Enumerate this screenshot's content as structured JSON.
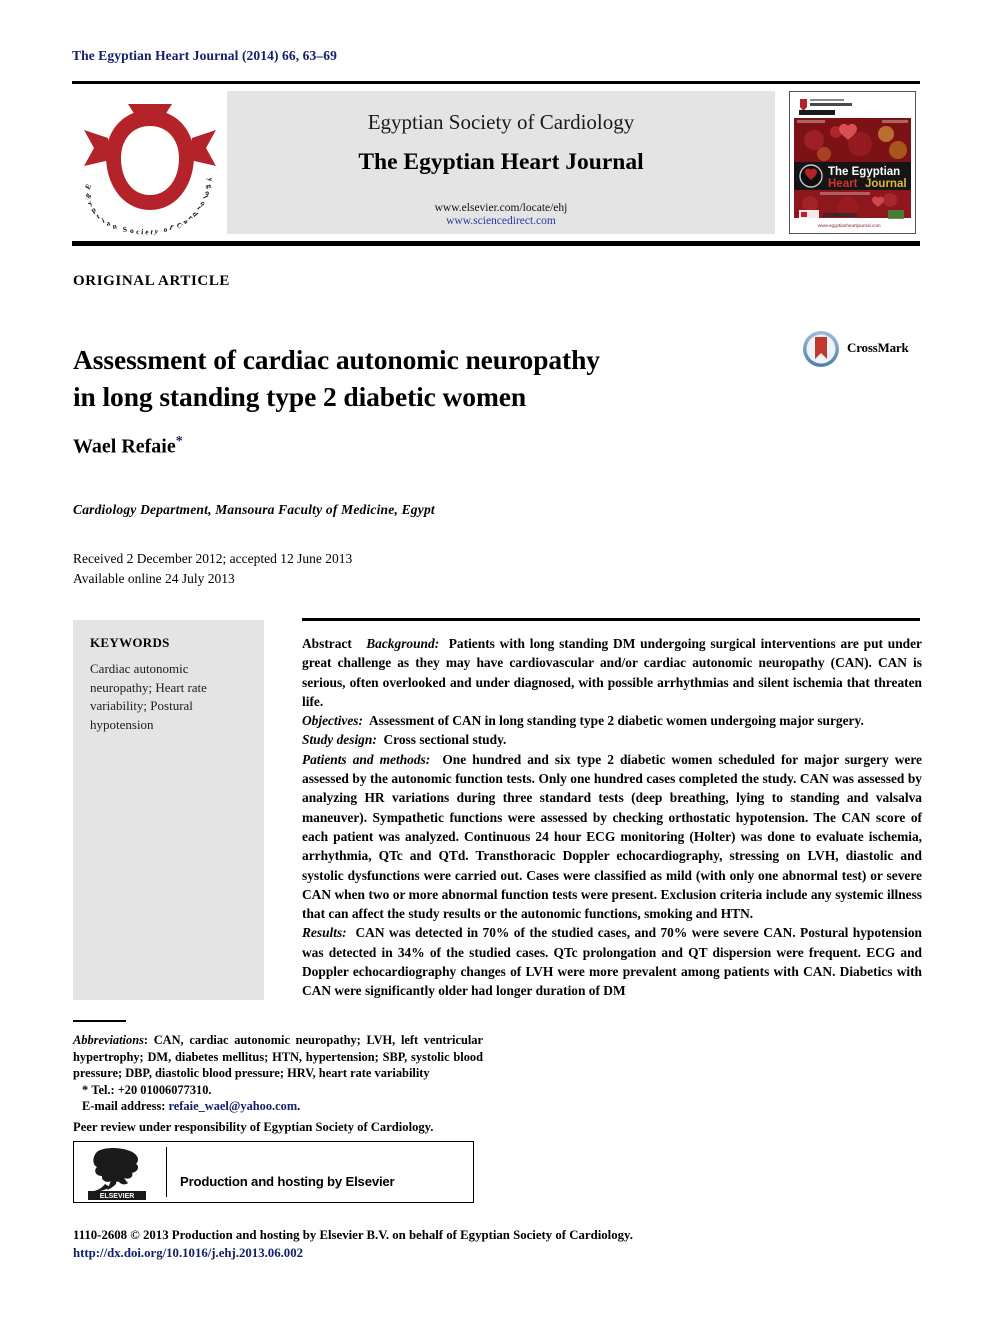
{
  "running_head": "The Egyptian Heart Journal (2014) 66, 63–69",
  "masthead": {
    "society": "Egyptian Society of Cardiology",
    "journal": "The Egyptian Heart Journal",
    "url_elsevier": "www.elsevier.com/locate/ehj",
    "url_sciencedirect": "www.sciencedirect.com",
    "logo_ring_text": "Egyptian Society of Cardiology",
    "cover": {
      "header_society": "Egyptian Society of Cardiology",
      "header_official": "OFFICIAL JOURNAL",
      "issue_date": "January 2014",
      "issn": "ISSN 1110-2608",
      "title_line1": "The Egyptian",
      "title_line2_a": "Heart",
      "title_line2_b": "Journal",
      "volume_line": "Vol 66 | Issue 1",
      "footer_url": "www.egyptianheartjournal.com"
    },
    "colors": {
      "logo_red": "#b5232a",
      "panel_gray": "#e4e4e4",
      "link_blue": "#2b37a0"
    }
  },
  "article": {
    "kicker": "ORIGINAL ARTICLE",
    "title_line1": "Assessment of cardiac autonomic neuropathy",
    "title_line2": "in long standing type 2 diabetic women",
    "crossmark_label": "CrossMark",
    "author": "Wael Refaie",
    "author_marker": "*",
    "affiliation": "Cardiology Department, Mansoura Faculty of Medicine, Egypt",
    "received": "Received 2 December 2012; accepted 12 June 2013",
    "available": "Available online 24 July 2013"
  },
  "keywords": {
    "heading": "KEYWORDS",
    "items": "Cardiac autonomic neuropathy; Heart rate variability; Postural hypotension"
  },
  "abstract": {
    "label": "Abstract",
    "background_label": "Background:",
    "background_text": "Patients with long standing DM undergoing surgical interventions are put under great challenge as they may have cardiovascular and/or cardiac autonomic neuropathy (CAN). CAN is serious, often overlooked and under diagnosed, with possible arrhythmias and silent ischemia that threaten life.",
    "objectives_label": "Objectives:",
    "objectives_text": "Assessment of CAN in long standing type 2 diabetic women undergoing major surgery.",
    "study_design_label": "Study design:",
    "study_design_text": "Cross sectional study.",
    "methods_label": "Patients and methods:",
    "methods_text": "One hundred and six type 2 diabetic women scheduled for major surgery were assessed by the autonomic function tests. Only one hundred cases completed the study. CAN was assessed by analyzing HR variations during three standard tests (deep breathing, lying to standing and valsalva maneuver). Sympathetic functions were assessed by checking orthostatic hypotension. The CAN score of each patient was analyzed. Continuous 24 hour ECG monitoring (Holter) was done to evaluate ischemia, arrhythmia, QTc and QTd. Transthoracic Doppler echocardiography, stressing on LVH, diastolic and systolic dysfunctions were carried out. Cases were classified as mild (with only one abnormal test) or severe CAN when two or more abnormal function tests were present. Exclusion criteria include any systemic illness that can affect the study results or the autonomic functions, smoking and HTN.",
    "results_label": "Results:",
    "results_text": "CAN was detected in 70% of the studied cases, and 70% were severe CAN. Postural hypotension was detected in 34% of the studied cases. QTc prolongation and QT dispersion were frequent. ECG and Doppler echocardiography changes of LVH were more prevalent among patients with CAN. Diabetics with CAN were significantly older had longer duration of DM"
  },
  "footnotes": {
    "abbreviations_label": "Abbreviations",
    "abbreviations_text": ": CAN, cardiac autonomic neuropathy; LVH, left ventricular hypertrophy; DM, diabetes mellitus; HTN, hypertension; SBP, systolic blood pressure; DBP, diastolic blood pressure; HRV, heart rate variability",
    "tel_marker": "*",
    "tel": "Tel.: +20 01006077310.",
    "email_label": "E-mail address:",
    "email": "refaie_wael@yahoo.com",
    "peer_review": "Peer review under responsibility of Egyptian Society of Cardiology.",
    "elsevier_box_text": "Production and hosting by Elsevier",
    "elsevier_wordmark": "ELSEVIER",
    "copyright": "1110-2608 © 2013 Production and hosting by Elsevier B.V. on behalf of Egyptian Society of Cardiology.",
    "doi": "http://dx.doi.org/10.1016/j.ehj.2013.06.002"
  }
}
